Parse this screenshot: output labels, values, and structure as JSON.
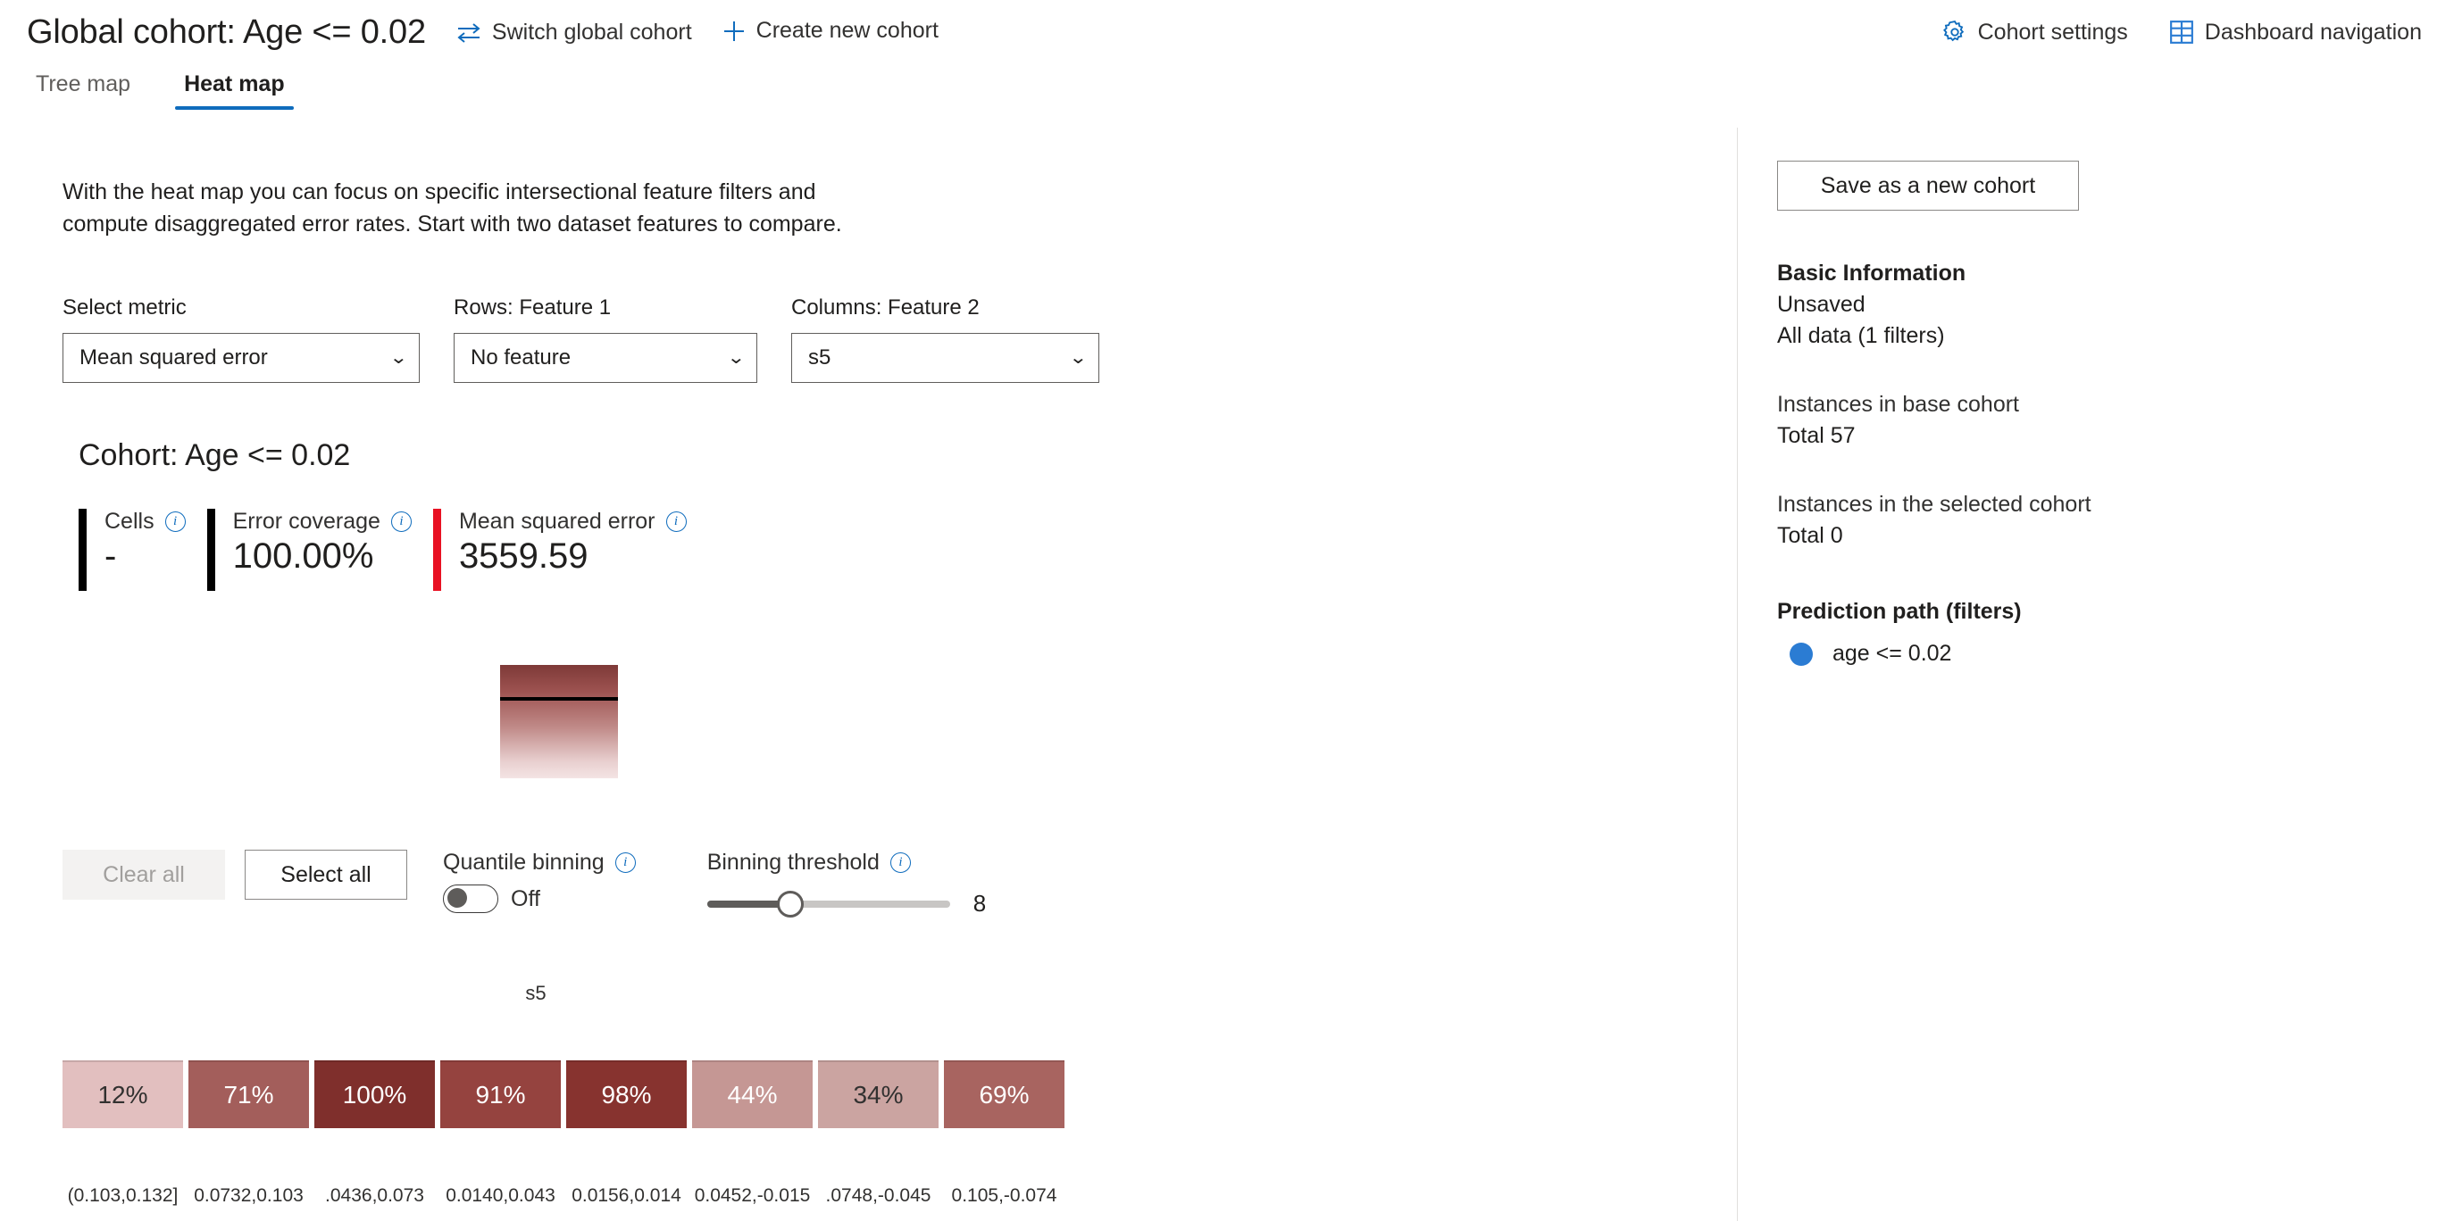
{
  "header": {
    "global_cohort_title": "Global cohort: Age <= 0.02",
    "switch_cohort": "Switch global cohort",
    "create_cohort": "Create new cohort",
    "cohort_settings": "Cohort settings",
    "dashboard_navigation": "Dashboard navigation",
    "accent_color": "#0f6cbd"
  },
  "tabs": [
    {
      "label": "Tree map",
      "active": false
    },
    {
      "label": "Heat map",
      "active": true
    }
  ],
  "main": {
    "intro_line1": "With the heat map you can focus on specific intersectional feature filters and",
    "intro_line2": "compute disaggregated error rates. Start with two dataset features to compare.",
    "selectors": [
      {
        "label": "Select metric",
        "value": "Mean squared error"
      },
      {
        "label": "Rows: Feature 1",
        "value": "No feature"
      },
      {
        "label": "Columns: Feature 2",
        "value": "s5"
      }
    ],
    "cohort_heading": "Cohort: Age <= 0.02",
    "stats": [
      {
        "name": "Cells",
        "value": "-",
        "bar_color": "#000000"
      },
      {
        "name": "Error coverage",
        "value": "100.00%",
        "bar_color": "#000000"
      },
      {
        "name": "Mean squared error",
        "value": "3559.59",
        "bar_color": "#e81123"
      }
    ],
    "controls": {
      "clear_all": "Clear all",
      "select_all": "Select all",
      "quantile_binning_label": "Quantile binning",
      "quantile_binning_state": "Off",
      "binning_threshold_label": "Binning threshold",
      "binning_threshold_value": "8"
    }
  },
  "chart_data": {
    "type": "heatmap",
    "title": "",
    "xlabel": "s5",
    "ylabel": "",
    "metric": "Mean squared error",
    "cell_unit": "%",
    "categories": [
      "(0.103,0.132]",
      "(0.0732,0.103]",
      "(0.0436,0.0732]",
      "(0.0140,0.0436]",
      "(-0.0156,0.0140]",
      "(-0.0452,-0.0156]",
      "(-0.0748,-0.0452]",
      "(-0.105,-0.0748]"
    ],
    "display_labels": [
      "(0.103,0.132]",
      "0.0732,0.103",
      ".0436,0.073",
      "0.0140,0.043",
      "0.0156,0.014",
      "0.0452,-0.015",
      ".0748,-0.045",
      "0.105,-0.074"
    ],
    "values": [
      12,
      71,
      100,
      91,
      98,
      44,
      34,
      69
    ],
    "cell_labels": [
      "12%",
      "71%",
      "100%",
      "91%",
      "98%",
      "44%",
      "34%",
      "69%"
    ],
    "cell_colors": [
      "#e2bfbf",
      "#a35e5b",
      "#7f2f2c",
      "#95433f",
      "#87332f",
      "#c59794",
      "#cba4a1",
      "#a86460"
    ],
    "cell_text_colors": [
      "#323130",
      "#ffffff",
      "#ffffff",
      "#ffffff",
      "#ffffff",
      "#ffffff",
      "#323130",
      "#ffffff"
    ],
    "legend_gradient_top": "#7e3a38",
    "legend_gradient_bottom": "#f4e4e4",
    "grid": false,
    "legend_position": "left"
  },
  "sidebar": {
    "save_button": "Save as a new cohort",
    "basic_info_heading": "Basic Information",
    "basic_info_status": "Unsaved",
    "basic_info_data": "All data (1 filters)",
    "base_cohort_label": "Instances in base cohort",
    "base_cohort_total": "Total 57",
    "selected_cohort_label": "Instances in the selected cohort",
    "selected_cohort_total": "Total 0",
    "prediction_path_heading": "Prediction path (filters)",
    "prediction_path_items": [
      {
        "text": "age <= 0.02",
        "dot_color": "#2b7cd3"
      }
    ]
  }
}
